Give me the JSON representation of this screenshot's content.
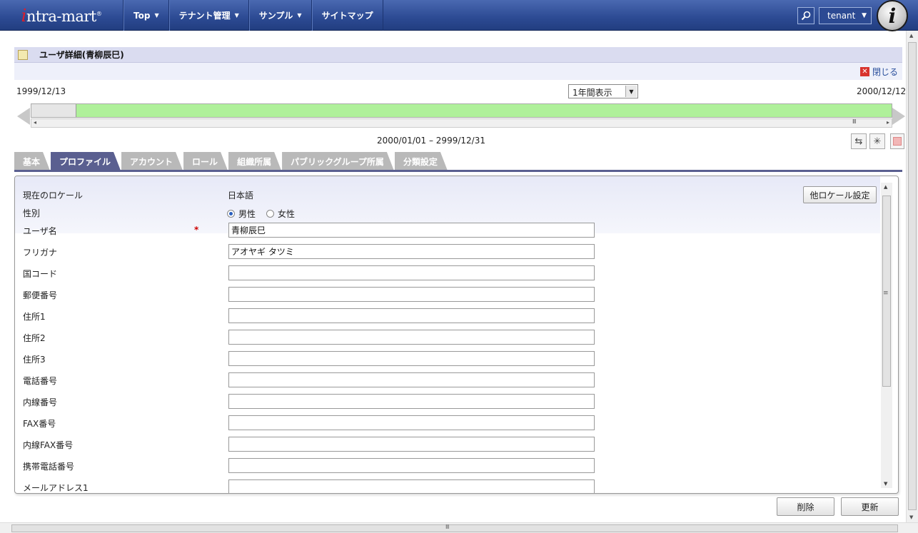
{
  "nav": {
    "logo_i": "i",
    "logo_text": "ntra-mart",
    "logo_reg": "®",
    "menu": [
      {
        "label": "Top",
        "caret": true
      },
      {
        "label": "テナント管理",
        "caret": true
      },
      {
        "label": "サンプル",
        "caret": true
      },
      {
        "label": "サイトマップ",
        "caret": false
      }
    ],
    "tenant": "tenant",
    "user_icon_letter": "i"
  },
  "page": {
    "title": "ユーザ詳細(青柳辰巳)",
    "close_label": "閉じる"
  },
  "timeline": {
    "start_date": "1999/12/13",
    "end_date": "2000/12/12",
    "period_option": "1年間表示",
    "range_text": "2000/01/01 – 2999/12/31",
    "active_from_fraction": 0.052
  },
  "tabs": [
    {
      "label": "基本",
      "active": false
    },
    {
      "label": "プロファイル",
      "active": true
    },
    {
      "label": "アカウント",
      "active": false
    },
    {
      "label": "ロール",
      "active": false
    },
    {
      "label": "組織所属",
      "active": false
    },
    {
      "label": "パブリックグループ所属",
      "active": false
    },
    {
      "label": "分類設定",
      "active": false
    }
  ],
  "form": {
    "locale_label": "現在のロケール",
    "locale_value": "日本語",
    "locale_button": "他ロケール設定",
    "gender_label": "性別",
    "gender_male": "男性",
    "gender_female": "女性",
    "gender_selected": "male",
    "required_mark": "*",
    "fields": [
      {
        "label": "ユーザ名",
        "value": "青柳辰巳",
        "required": true
      },
      {
        "label": "フリガナ",
        "value": "アオヤギ タツミ",
        "required": false
      },
      {
        "label": "国コード",
        "value": "",
        "required": false
      },
      {
        "label": "郵便番号",
        "value": "",
        "required": false
      },
      {
        "label": "住所1",
        "value": "",
        "required": false
      },
      {
        "label": "住所2",
        "value": "",
        "required": false
      },
      {
        "label": "住所3",
        "value": "",
        "required": false
      },
      {
        "label": "電話番号",
        "value": "",
        "required": false
      },
      {
        "label": "内線番号",
        "value": "",
        "required": false
      },
      {
        "label": "FAX番号",
        "value": "",
        "required": false
      },
      {
        "label": "内線FAX番号",
        "value": "",
        "required": false
      },
      {
        "label": "携帯電話番号",
        "value": "",
        "required": false
      },
      {
        "label": "メールアドレス1",
        "value": "",
        "required": false
      }
    ]
  },
  "actions": {
    "delete": "削除",
    "update": "更新"
  },
  "colors": {
    "nav_bg": "#2c4a93",
    "active_tab": "#5a5f90",
    "timeline_active": "#aff09a",
    "required": "#cc0000"
  }
}
